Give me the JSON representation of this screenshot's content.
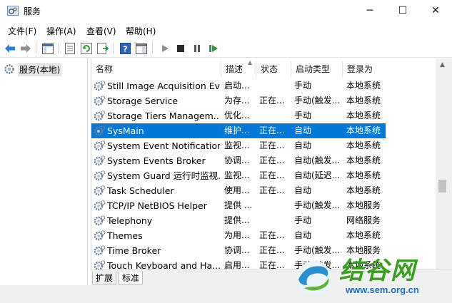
{
  "window": {
    "title": "服务",
    "minimize": "─",
    "maximize": "☐",
    "close": "✕"
  },
  "menu": [
    "文件(F)",
    "操作(A)",
    "查看(V)",
    "帮助(H)"
  ],
  "tree": {
    "item": "服务(本地)"
  },
  "columns": [
    "名称",
    "描述",
    "状态",
    "启动类型",
    "登录为"
  ],
  "rows": [
    {
      "name": "Still Image Acquisition Ev...",
      "desc": "启动...",
      "status": "",
      "start": "手动",
      "logon": "本地系统"
    },
    {
      "name": "Storage Service",
      "desc": "为存...",
      "status": "正在...",
      "start": "手动(触发...",
      "logon": "本地系统"
    },
    {
      "name": "Storage Tiers Managem...",
      "desc": "优化...",
      "status": "",
      "start": "手动",
      "logon": "本地系统"
    },
    {
      "name": "SysMain",
      "desc": "维护...",
      "status": "正在...",
      "start": "自动",
      "logon": "本地系统",
      "selected": true
    },
    {
      "name": "System Event Notification...",
      "desc": "监视...",
      "status": "正在...",
      "start": "自动",
      "logon": "本地系统"
    },
    {
      "name": "System Events Broker",
      "desc": "协调...",
      "status": "正在...",
      "start": "自动(触发...",
      "logon": "本地系统"
    },
    {
      "name": "System Guard 运行时监视...",
      "desc": "监视...",
      "status": "正在...",
      "start": "自动(延迟...",
      "logon": "本地系统"
    },
    {
      "name": "Task Scheduler",
      "desc": "使用...",
      "status": "正在...",
      "start": "自动",
      "logon": "本地系统"
    },
    {
      "name": "TCP/IP NetBIOS Helper",
      "desc": "提供 ...",
      "status": "",
      "start": "手动(触发...",
      "logon": "本地服务"
    },
    {
      "name": "Telephony",
      "desc": "提供...",
      "status": "",
      "start": "手动",
      "logon": "网络服务"
    },
    {
      "name": "Themes",
      "desc": "为用...",
      "status": "正在...",
      "start": "自动",
      "logon": "本地系统"
    },
    {
      "name": "Time Broker",
      "desc": "协调...",
      "status": "正在...",
      "start": "手动(触发...",
      "logon": "本地服务"
    },
    {
      "name": "Touch Keyboard and Ha...",
      "desc": "启用...",
      "status": "正在...",
      "start": "手动(触发...",
      "logon": "本地系统"
    }
  ],
  "tabs": [
    "扩展",
    "标准"
  ],
  "watermark": {
    "text": "结谷网",
    "url": "www.sem.org.cn"
  },
  "colors": {
    "selection": "#0078d7",
    "accent_green": "#3a9e1e",
    "accent_blue": "#1f6fc2"
  }
}
